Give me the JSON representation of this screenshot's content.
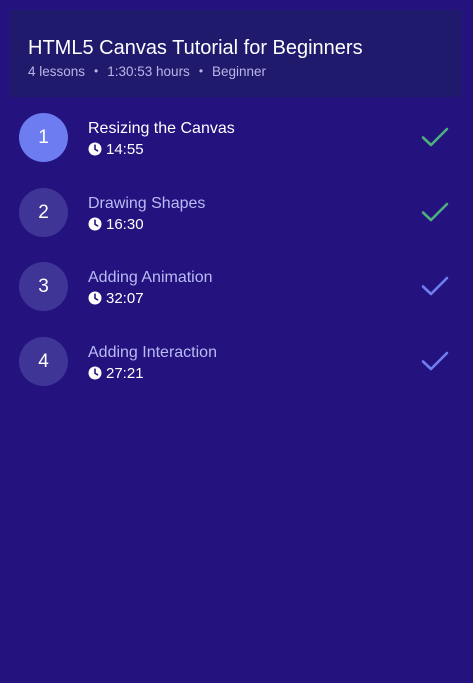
{
  "course": {
    "title": "HTML5 Canvas Tutorial for Beginners",
    "lessons_count": "4 lessons",
    "duration": "1:30:53 hours",
    "level": "Beginner"
  },
  "lessons": [
    {
      "number": "1",
      "title": "Resizing the Canvas",
      "duration": "14:55",
      "status": "completed",
      "active": true
    },
    {
      "number": "2",
      "title": "Drawing Shapes",
      "duration": "16:30",
      "status": "completed",
      "active": false
    },
    {
      "number": "3",
      "title": "Adding Animation",
      "duration": "32:07",
      "status": "not-completed",
      "active": false
    },
    {
      "number": "4",
      "title": "Adding Interaction",
      "duration": "27:21",
      "status": "not-completed",
      "active": false
    }
  ],
  "colors": {
    "background": "#24127f",
    "header_background": "#1f1a6c",
    "active_circle": "#6d7cf1",
    "inactive_circle": "#3f3597",
    "check_completed": "#4caf7d",
    "check_incomplete": "#6f7ff2"
  },
  "icons": {
    "clock": "clock-icon",
    "check": "checkmark-icon"
  }
}
